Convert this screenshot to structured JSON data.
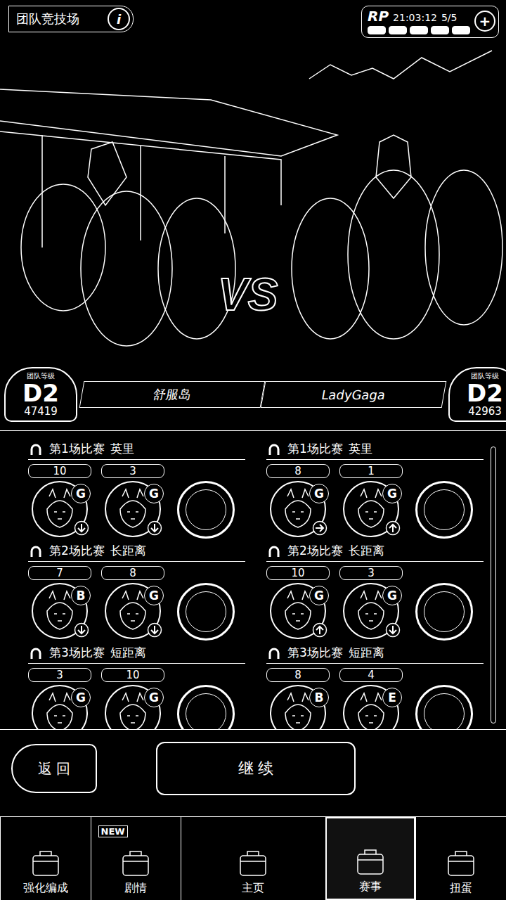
{
  "header": {
    "title": "团队竞技场",
    "info": "i",
    "rp_label": "RP",
    "timer": "21:03:12",
    "rp_count": "5/5",
    "plus": "+",
    "rp_points": [
      {
        "filled": true
      },
      {
        "filled": true
      },
      {
        "filled": true
      },
      {
        "filled": true
      },
      {
        "filled": true
      }
    ]
  },
  "scene": {
    "vs": "VS"
  },
  "player": {
    "name": "舒服岛",
    "rank_label": "团队等级",
    "rank": "D2",
    "score": "47419"
  },
  "opponent": {
    "name": "LadyGaga",
    "rank_label": "团队等级",
    "rank": "D2",
    "score": "42963"
  },
  "races": {
    "player": [
      {
        "title": "第1场比赛",
        "distance": "英里",
        "empty_slots": 1,
        "runners": [
          {
            "number": "10",
            "grade": "G",
            "trend": "down"
          },
          {
            "number": "3",
            "grade": "G",
            "trend": "down"
          }
        ]
      },
      {
        "title": "第2场比赛",
        "distance": "长距离",
        "empty_slots": 1,
        "runners": [
          {
            "number": "7",
            "grade": "B",
            "trend": "down"
          },
          {
            "number": "8",
            "grade": "G",
            "trend": "down"
          }
        ]
      },
      {
        "title": "第3场比赛",
        "distance": "短距离",
        "empty_slots": 1,
        "runners": [
          {
            "number": "3",
            "grade": "G"
          },
          {
            "number": "10",
            "grade": "G"
          }
        ]
      }
    ],
    "opponent": [
      {
        "title": "第1场比赛",
        "distance": "英里",
        "empty_slots": 1,
        "runners": [
          {
            "number": "8",
            "grade": "G",
            "trend": "right"
          },
          {
            "number": "1",
            "grade": "G",
            "trend": "up"
          }
        ]
      },
      {
        "title": "第2场比赛",
        "distance": "长距离",
        "empty_slots": 1,
        "runners": [
          {
            "number": "10",
            "grade": "G",
            "trend": "up"
          },
          {
            "number": "3",
            "grade": "G",
            "trend": "down"
          }
        ]
      },
      {
        "title": "第3场比赛",
        "distance": "短距离",
        "empty_slots": 1,
        "runners": [
          {
            "number": "8",
            "grade": "B"
          },
          {
            "number": "4",
            "grade": "E"
          }
        ]
      }
    ]
  },
  "buttons": {
    "back": "返 回",
    "continue": "继 续"
  },
  "nav": [
    {
      "label": "强化编成",
      "selected": false
    },
    {
      "label": "剧情",
      "selected": false,
      "badge": "NEW"
    },
    {
      "label": "主页",
      "selected": false
    },
    {
      "label": "赛事",
      "selected": true
    },
    {
      "label": "扭蛋",
      "selected": false
    }
  ]
}
